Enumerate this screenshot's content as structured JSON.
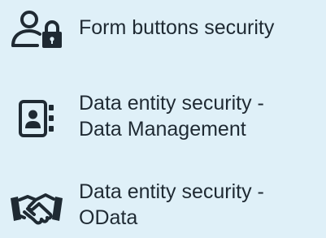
{
  "items": [
    {
      "icon": "user-lock-icon",
      "label": "Form buttons security"
    },
    {
      "icon": "contact-card-icon",
      "line1": "Data entity security -",
      "line2": "Data Management"
    },
    {
      "icon": "handshake-icon",
      "line1": "Data entity security -",
      "line2": "OData"
    }
  ],
  "colors": {
    "background": "#dff0f8",
    "text": "#1f2a33",
    "icon": "#1f2a33"
  }
}
